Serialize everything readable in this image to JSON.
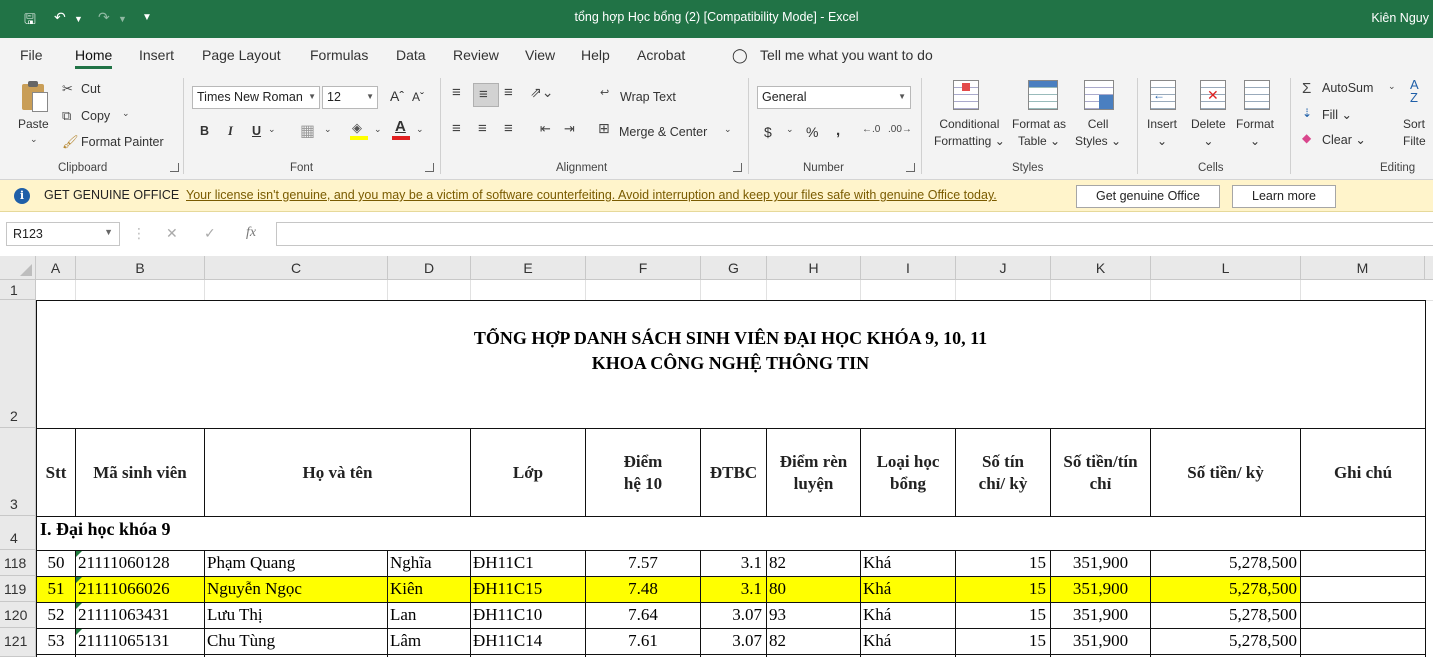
{
  "app": {
    "title": "tổng hợp Học bổng (2)  [Compatibility Mode]  -  Excel",
    "user": "Kiên Nguy",
    "accent": "#217346"
  },
  "tabs": [
    "File",
    "Home",
    "Insert",
    "Page Layout",
    "Formulas",
    "Data",
    "Review",
    "View",
    "Help",
    "Acrobat"
  ],
  "tell_me": "Tell me what you want to do",
  "ribbon": {
    "clipboard": {
      "paste": "Paste",
      "cut": "Cut",
      "copy": "Copy",
      "format_painter": "Format Painter",
      "label": "Clipboard"
    },
    "font": {
      "name": "Times New Roman",
      "size": "12",
      "label": "Font",
      "bold": "B",
      "italic": "I",
      "underline": "U"
    },
    "alignment": {
      "wrap": "Wrap Text",
      "merge": "Merge & Center",
      "label": "Alignment"
    },
    "number": {
      "format": "General",
      "label": "Number",
      "currency": "$",
      "percent": "%",
      "comma": ","
    },
    "styles": {
      "conditional": "Conditional",
      "formatting": "Formatting",
      "format_as": "Format as",
      "table": "Table",
      "cell": "Cell",
      "cell_styles": "Styles",
      "label": "Styles"
    },
    "cells": {
      "insert": "Insert",
      "delete": "Delete",
      "format": "Format",
      "label": "Cells"
    },
    "editing": {
      "autosum": "AutoSum",
      "fill": "Fill",
      "clear": "Clear",
      "sort": "Sort",
      "filter": "Filte",
      "label": "Editing"
    }
  },
  "message_bar": {
    "heading": "GET GENUINE OFFICE",
    "message": "Your license isn't genuine, and you may be a victim of software counterfeiting. Avoid interruption and keep your files safe with genuine Office today.",
    "button_primary": "Get genuine Office",
    "button_secondary": "Learn more",
    "background": "#fff4cb"
  },
  "formula_bar": {
    "name_box": "R123",
    "fx": "fx",
    "value": ""
  },
  "grid": {
    "columns": [
      "A",
      "B",
      "C",
      "D",
      "E",
      "F",
      "G",
      "H",
      "I",
      "J",
      "K",
      "L",
      "M"
    ],
    "row_numbers": [
      "1",
      "2",
      "3",
      "4",
      "118",
      "119",
      "120",
      "121"
    ],
    "title_line1": "TỔNG HỢP DANH SÁCH SINH VIÊN ĐẠI HỌC KHÓA 9, 10, 11",
    "title_line2": "KHOA CÔNG NGHỆ THÔNG TIN",
    "headers": [
      "Stt",
      "Mã sinh viên",
      "Họ và tên",
      "Lớp",
      "Điểm hệ 10",
      "ĐTBC",
      "Điểm rèn luyện",
      "Loại học bổng",
      "Số tín chỉ/ kỳ",
      "Số tiền/tín chỉ",
      "Số tiền/ kỳ",
      "Ghi chú"
    ],
    "section": "I. Đại học khóa 9",
    "highlight_color": "#ffff00",
    "rows": [
      {
        "stt": "50",
        "msv": "21111060128",
        "ho": "Phạm Quang",
        "ten": "Nghĩa",
        "lop": "ĐH11C1",
        "diem": "7.57",
        "dtbc": "3.1",
        "rl": "82",
        "loai": "Khá",
        "tc": "15",
        "tien_tc": "351,900",
        "tien_ky": "5,278,500",
        "highlight": false
      },
      {
        "stt": "51",
        "msv": "21111066026",
        "ho": "Nguyễn Ngọc",
        "ten": "Kiên",
        "lop": "ĐH11C15",
        "diem": "7.48",
        "dtbc": "3.1",
        "rl": "80",
        "loai": "Khá",
        "tc": "15",
        "tien_tc": "351,900",
        "tien_ky": "5,278,500",
        "highlight": true
      },
      {
        "stt": "52",
        "msv": "21111063431",
        "ho": "Lưu Thị",
        "ten": "Lan",
        "lop": "ĐH11C10",
        "diem": "7.64",
        "dtbc": "3.07",
        "rl": "93",
        "loai": "Khá",
        "tc": "15",
        "tien_tc": "351,900",
        "tien_ky": "5,278,500",
        "highlight": false
      },
      {
        "stt": "53",
        "msv": "21111065131",
        "ho": "Chu Tùng",
        "ten": "Lâm",
        "lop": "ĐH11C14",
        "diem": "7.61",
        "dtbc": "3.07",
        "rl": "82",
        "loai": "Khá",
        "tc": "15",
        "tien_tc": "351,900",
        "tien_ky": "5,278,500",
        "highlight": false
      }
    ]
  }
}
